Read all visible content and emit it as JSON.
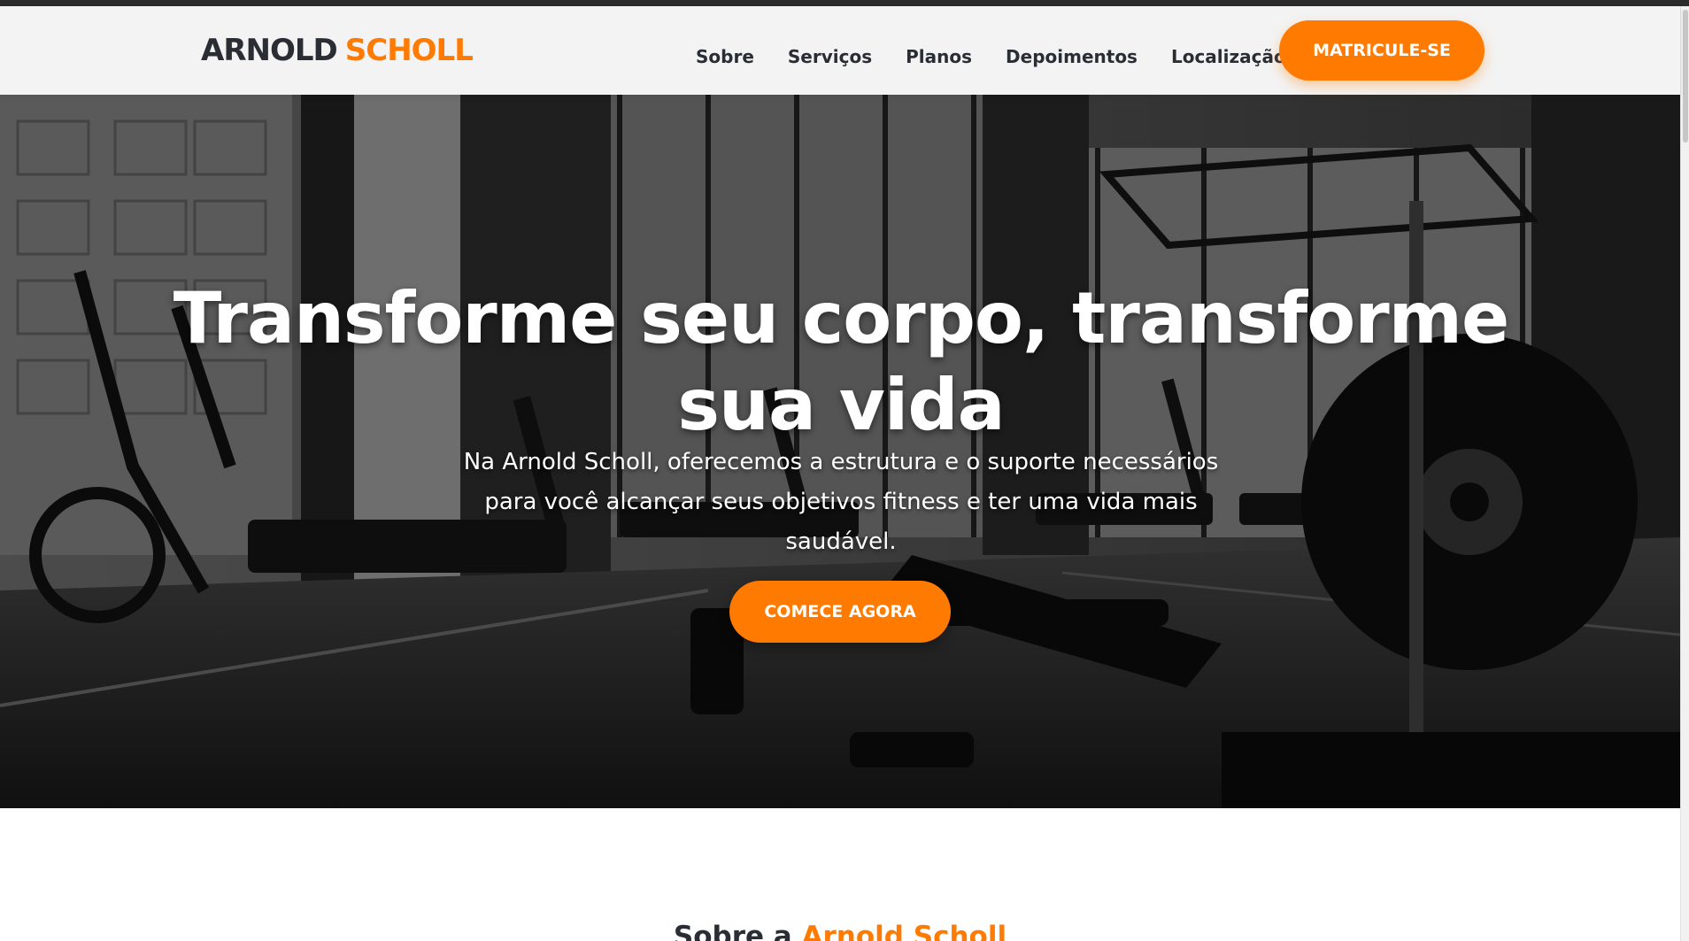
{
  "brand": {
    "name_part1": "ARNOLD",
    "name_part2": "SCHOLL",
    "accent_color": "#ff7a00",
    "dark_color": "#2a2d34"
  },
  "nav": {
    "items": [
      {
        "label": "Sobre"
      },
      {
        "label": "Serviços"
      },
      {
        "label": "Planos"
      },
      {
        "label": "Depoimentos"
      },
      {
        "label": "Localização"
      }
    ],
    "cta_label": "MATRICULE-SE"
  },
  "hero": {
    "title": "Transforme seu corpo, transforme sua vida",
    "subtitle": "Na Arnold Scholl, oferecemos a estrutura e o suporte necessários para você alcançar seus objetivos fitness e ter uma vida mais saudável.",
    "cta_label": "COMECE AGORA",
    "background": "gym-photo-grayscale"
  },
  "about": {
    "title_prefix": "Sobre a",
    "title_accent": "Arnold Scholl"
  }
}
